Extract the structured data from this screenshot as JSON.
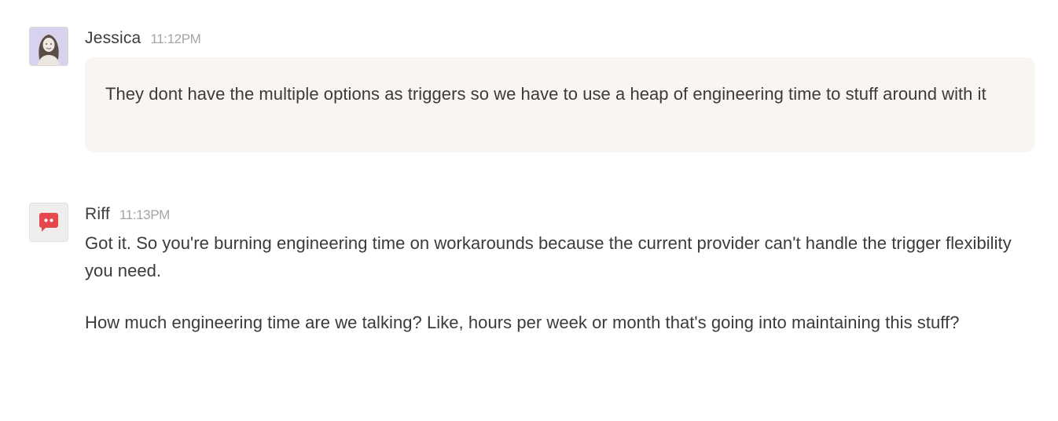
{
  "messages": [
    {
      "author": "Jessica",
      "time": "11:12PM",
      "avatar_icon": "user-photo",
      "paragraphs": [
        "They dont have the multiple options as triggers so we have to use a heap of engineering time to stuff around with it"
      ]
    },
    {
      "author": "Riff",
      "time": "11:13PM",
      "avatar_icon": "chat-bubble-bot-icon",
      "paragraphs": [
        "Got it. So you're burning engineering time on workarounds because the current provider can't handle the trigger flexibility you need.",
        "How much engineering time are we talking? Like, hours per week or month that's going into maintaining this stuff?"
      ]
    }
  ],
  "colors": {
    "bubble_background": "#f9f6f1",
    "bot_icon": "#e5484d",
    "timestamp": "#a8a5a0",
    "text": "#3d3a37"
  }
}
